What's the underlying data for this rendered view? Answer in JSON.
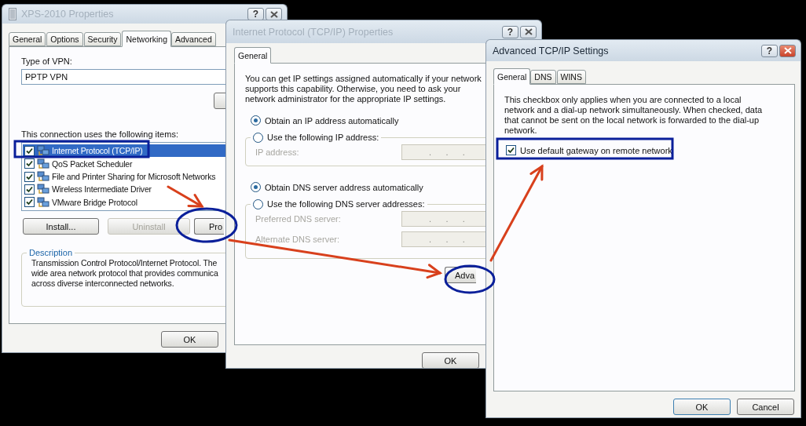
{
  "vpn_properties": {
    "title": "XPS-2010 Properties",
    "active": false,
    "help_label": "?",
    "tabs": [
      {
        "label": "General",
        "selected": false
      },
      {
        "label": "Options",
        "selected": false
      },
      {
        "label": "Security",
        "selected": false
      },
      {
        "label": "Networking",
        "selected": true
      },
      {
        "label": "Advanced",
        "selected": false
      }
    ],
    "vpn_type_label": "Type of VPN:",
    "vpn_type_value": "PPTP VPN",
    "items_label": "This connection uses the following items:",
    "items": [
      {
        "label": "Internet Protocol (TCP/IP)",
        "checked": true,
        "selected": true
      },
      {
        "label": "QoS Packet Scheduler",
        "checked": true,
        "selected": false
      },
      {
        "label": "File and Printer Sharing for Microsoft Networks",
        "checked": true,
        "selected": false
      },
      {
        "label": "Wireless Intermediate Driver",
        "checked": true,
        "selected": false
      },
      {
        "label": "VMware Bridge Protocol",
        "checked": true,
        "selected": false
      }
    ],
    "buttons": [
      {
        "label": "Install...",
        "kind": "full",
        "disabled": false
      },
      {
        "label": "Uninstall",
        "kind": "full",
        "disabled": true
      },
      {
        "label": "Pro",
        "kind": "cut",
        "disabled": false
      }
    ],
    "description": {
      "title": "Description",
      "lines": [
        "Transmission Control Protocol/Internet Protocol. The",
        "wide area network protocol that provides communica",
        "across diverse interconnected networks."
      ]
    },
    "ok_label": "OK"
  },
  "tcpip_properties": {
    "title": "Internet Protocol (TCP/IP) Properties",
    "active": false,
    "help_label": "?",
    "tabs": [
      {
        "label": "General",
        "selected": true
      }
    ],
    "intro": "You can get IP settings assigned automatically if your network supports this capability. Otherwise, you need to ask your network administrator for the appropriate IP settings.",
    "ip_options": [
      {
        "label": "Obtain an IP address automatically",
        "selected": true
      },
      {
        "label": "Use the following IP address:",
        "selected": false
      }
    ],
    "ip_fields": [
      {
        "label": "IP address:",
        "value": ".      .      .",
        "disabled": true
      }
    ],
    "dns_options": [
      {
        "label": "Obtain DNS server address automatically",
        "selected": true
      },
      {
        "label": "Use the following DNS server addresses:",
        "selected": false
      }
    ],
    "dns_fields": [
      {
        "label": "Preferred DNS server:",
        "value": ".      .      .",
        "disabled": true
      },
      {
        "label": "Alternate DNS server:",
        "value": ".      .      .",
        "disabled": true
      }
    ],
    "advanced_label": "Adva",
    "ok_label": "OK"
  },
  "advanced_settings": {
    "title": "Advanced TCP/IP Settings",
    "active": true,
    "help_label": "?",
    "tabs": [
      {
        "label": "General",
        "selected": true
      },
      {
        "label": "DNS",
        "selected": false
      },
      {
        "label": "WINS",
        "selected": false
      }
    ],
    "info": "This checkbox only applies when you are connected to a local network and a dial-up network simultaneously.  When checked, data that cannot be sent on the local network is forwarded to the dial-up network.",
    "gateway": {
      "label": "Use default gateway on remote network",
      "checked": true
    },
    "ok_label": "OK",
    "cancel_label": "Cancel"
  }
}
